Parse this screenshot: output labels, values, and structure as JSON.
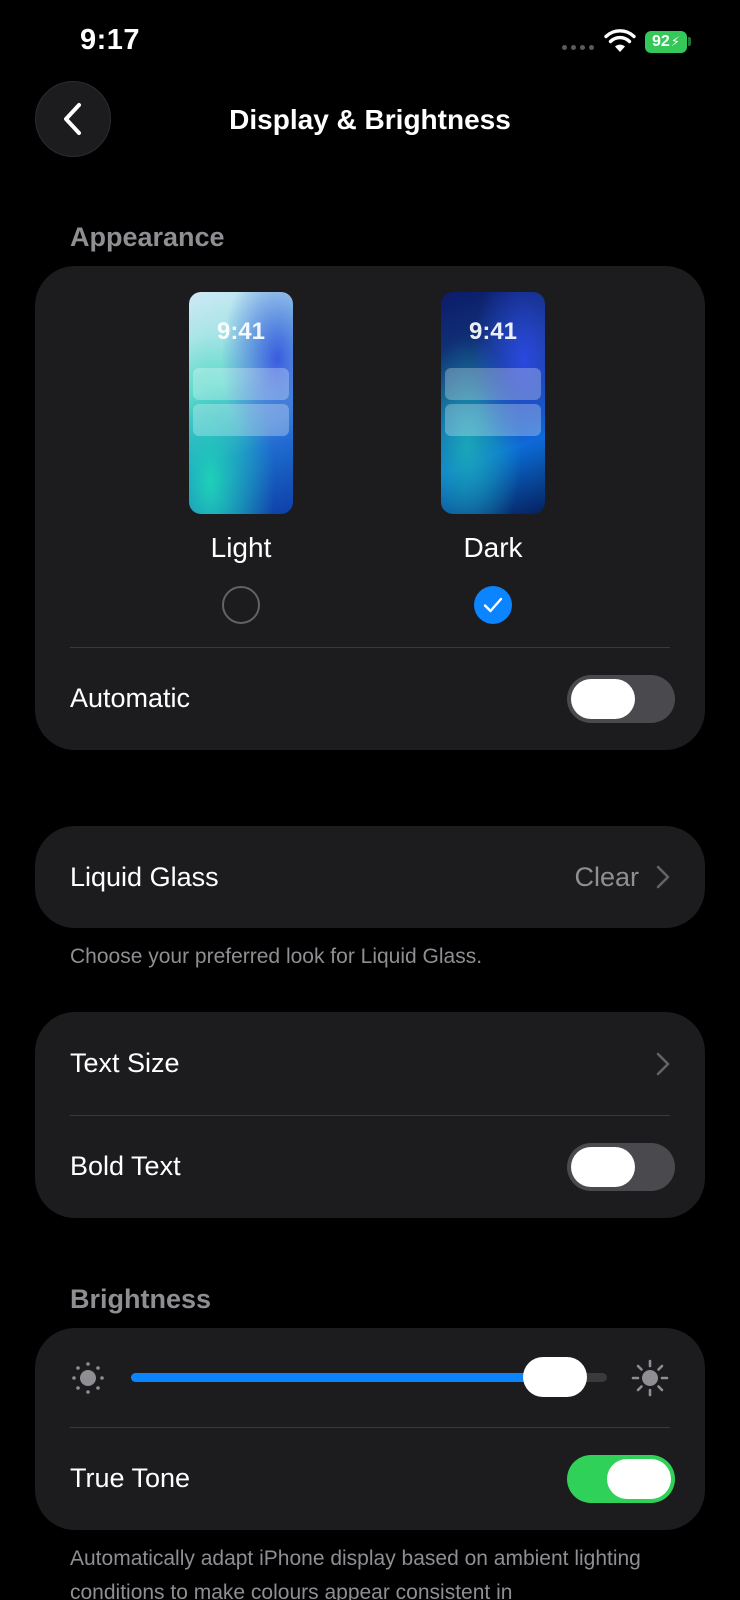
{
  "status_bar": {
    "time": "9:17",
    "battery": "92"
  },
  "nav": {
    "back_icon": "chevron-left-icon",
    "title": "Display & Brightness"
  },
  "appearance": {
    "header": "Appearance",
    "options": [
      {
        "label": "Light",
        "preview_time": "9:41",
        "selected": false
      },
      {
        "label": "Dark",
        "preview_time": "9:41",
        "selected": true
      }
    ],
    "automatic": {
      "label": "Automatic",
      "on": false
    }
  },
  "liquid_glass": {
    "label": "Liquid Glass",
    "value": "Clear",
    "footer": "Choose your preferred look for Liquid Glass."
  },
  "text": {
    "text_size_label": "Text Size",
    "bold_text": {
      "label": "Bold Text",
      "on": false
    }
  },
  "brightness": {
    "header": "Brightness",
    "level": 0.89,
    "true_tone": {
      "label": "True Tone",
      "on": true
    },
    "footer": "Automatically adapt iPhone display based on ambient lighting conditions to make colours appear consistent in"
  },
  "colors": {
    "accent": "#0a84ff",
    "toggle_on": "#30d158",
    "card": "#1c1c1e",
    "secondary_text": "#8e8e93"
  }
}
